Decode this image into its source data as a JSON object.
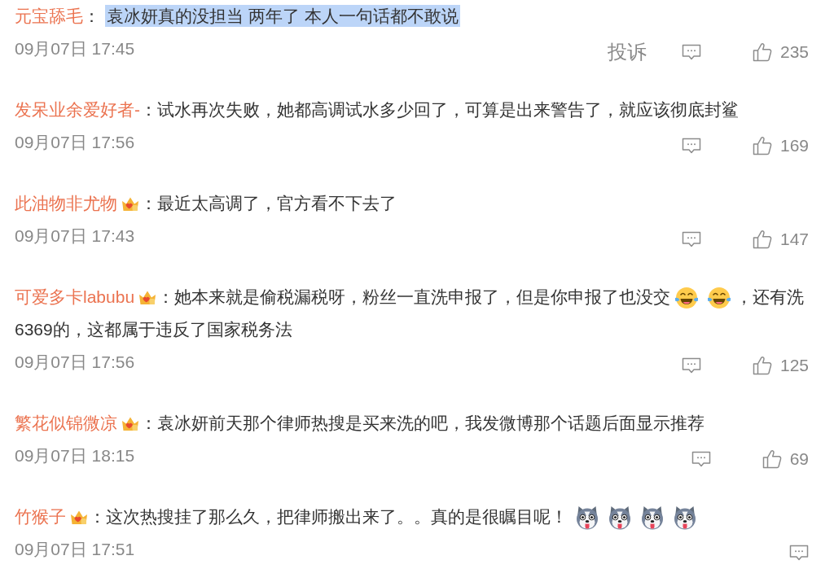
{
  "comments": [
    {
      "user": {
        "name": "元宝舔毛",
        "badge": false
      },
      "separator": "：",
      "content": [
        {
          "kind": "text",
          "text": "袁冰妍真的没担当 两年了 本人一句话都不敢说",
          "highlighted": true
        }
      ],
      "time": "09月07日 17:45",
      "report": "投诉",
      "likes": "235"
    },
    {
      "user": {
        "name": "发呆业余爱好者-",
        "badge": false
      },
      "separator": "：",
      "content": [
        {
          "kind": "text",
          "text": "试水再次失败，她都高调试水多少回了，可算是出来警告了，就应该彻底封鲨",
          "highlighted": false
        }
      ],
      "time": "09月07日 17:56",
      "likes": "169"
    },
    {
      "user": {
        "name": "此油物非尤物",
        "badge": true
      },
      "separator": "：",
      "content": [
        {
          "kind": "text",
          "text": "最近太高调了，官方看不下去了",
          "highlighted": false
        }
      ],
      "time": "09月07日 17:43",
      "likes": "147"
    },
    {
      "user": {
        "name": "可爱多卡labubu",
        "badge": true
      },
      "separator": "：",
      "content": [
        {
          "kind": "text",
          "text": "她本来就是偷税漏税呀，粉丝一直洗申报了，但是你申报了也没交",
          "highlighted": false
        },
        {
          "kind": "laugh"
        },
        {
          "kind": "laugh"
        },
        {
          "kind": "text",
          "text": "，还有洗",
          "highlighted": false
        },
        {
          "kind": "text",
          "text": "6369的，这都属于违反了国家税务法",
          "highlighted": false
        }
      ],
      "time": "09月07日 17:56",
      "likes": "125"
    },
    {
      "user": {
        "name": "繁花似锦微凉",
        "badge": true
      },
      "separator": "：",
      "content": [
        {
          "kind": "text",
          "text": "袁冰妍前天那个律师热搜是买来洗的吧，我发微博那个话题后面显示推荐",
          "highlighted": false
        }
      ],
      "time": "09月07日 18:15",
      "likes": "69"
    },
    {
      "user": {
        "name": "竹猴子",
        "badge": true
      },
      "separator": "：",
      "content": [
        {
          "kind": "text",
          "text": "这次热搜挂了那么久，把律师搬出来了。。真的是很瞩目呢！",
          "highlighted": false
        },
        {
          "kind": "husky"
        },
        {
          "kind": "husky"
        },
        {
          "kind": "husky"
        },
        {
          "kind": "husky"
        }
      ],
      "time": "09月07日 17:51"
    }
  ]
}
